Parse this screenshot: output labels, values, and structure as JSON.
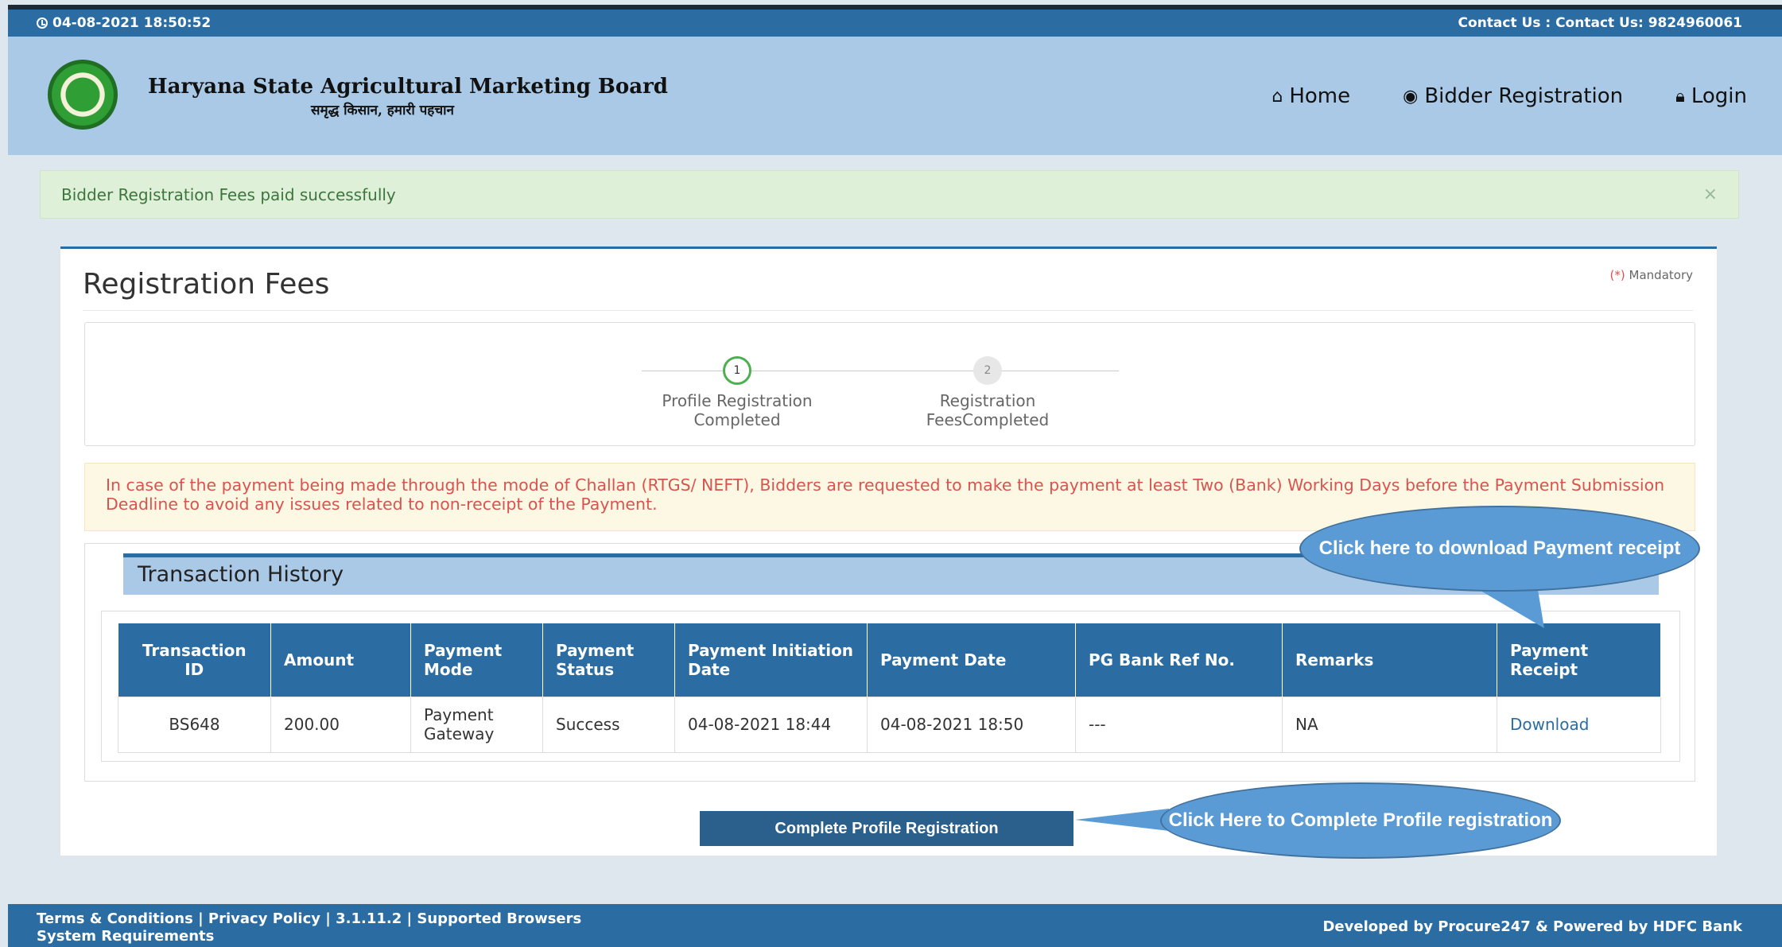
{
  "topbar": {
    "datetime": "04-08-2021 18:50:52",
    "contact": "Contact Us : Contact Us: 9824960061"
  },
  "header": {
    "title": "Haryana State Agricultural Marketing Board",
    "tagline": "समृद्ध किसान, हमारी पहचान",
    "nav": {
      "home": "Home",
      "bidder_registration": "Bidder Registration",
      "login": "Login"
    }
  },
  "alert": {
    "message": "Bidder Registration Fees paid successfully",
    "close": "×"
  },
  "panel": {
    "title": "Registration Fees",
    "mandatory_mark": "(*)",
    "mandatory_label": "Mandatory"
  },
  "steps": [
    {
      "num": "1",
      "line1": "Profile Registration",
      "line2": "Completed"
    },
    {
      "num": "2",
      "line1": "Registration",
      "line2": "FeesCompleted"
    }
  ],
  "warning": "In case of the payment being made through the mode of Challan (RTGS/ NEFT), Bidders are requested to make the payment at least Two (Bank) Working Days before the Payment Submission Deadline to avoid any issues related to non-receipt of the Payment.",
  "transaction": {
    "title": "Transaction History",
    "columns": [
      "Transaction ID",
      "Amount",
      "Payment Mode",
      "Payment Status",
      "Payment Initiation Date",
      "Payment Date",
      "PG Bank Ref No.",
      "Remarks",
      "Payment Receipt"
    ],
    "rows": [
      {
        "transaction_id": "BS648",
        "amount": "200.00",
        "payment_mode": "Payment Gateway",
        "payment_status": "Success",
        "initiation_date": "04-08-2021 18:44",
        "payment_date": "04-08-2021 18:50",
        "pg_bank_ref": "---",
        "remarks": "NA",
        "receipt": "Download"
      }
    ]
  },
  "button": {
    "complete_profile": "Complete Profile Registration"
  },
  "callouts": {
    "download": "Click here to download Payment receipt",
    "complete": "Click Here to Complete Profile registration"
  },
  "footer": {
    "terms": "Terms & Conditions",
    "privacy": "Privacy Policy",
    "version": "3.1.11.2",
    "browsers": "Supported Browsers",
    "system": "System Requirements",
    "credit": "Developed by Procure247 & Powered by HDFC Bank"
  },
  "colors": {
    "primary": "#2b6da3",
    "header_bg": "#a9c9e6",
    "success_bg": "#dff0d8",
    "warning_text": "#d9534f",
    "callout": "#5b9bd5"
  }
}
